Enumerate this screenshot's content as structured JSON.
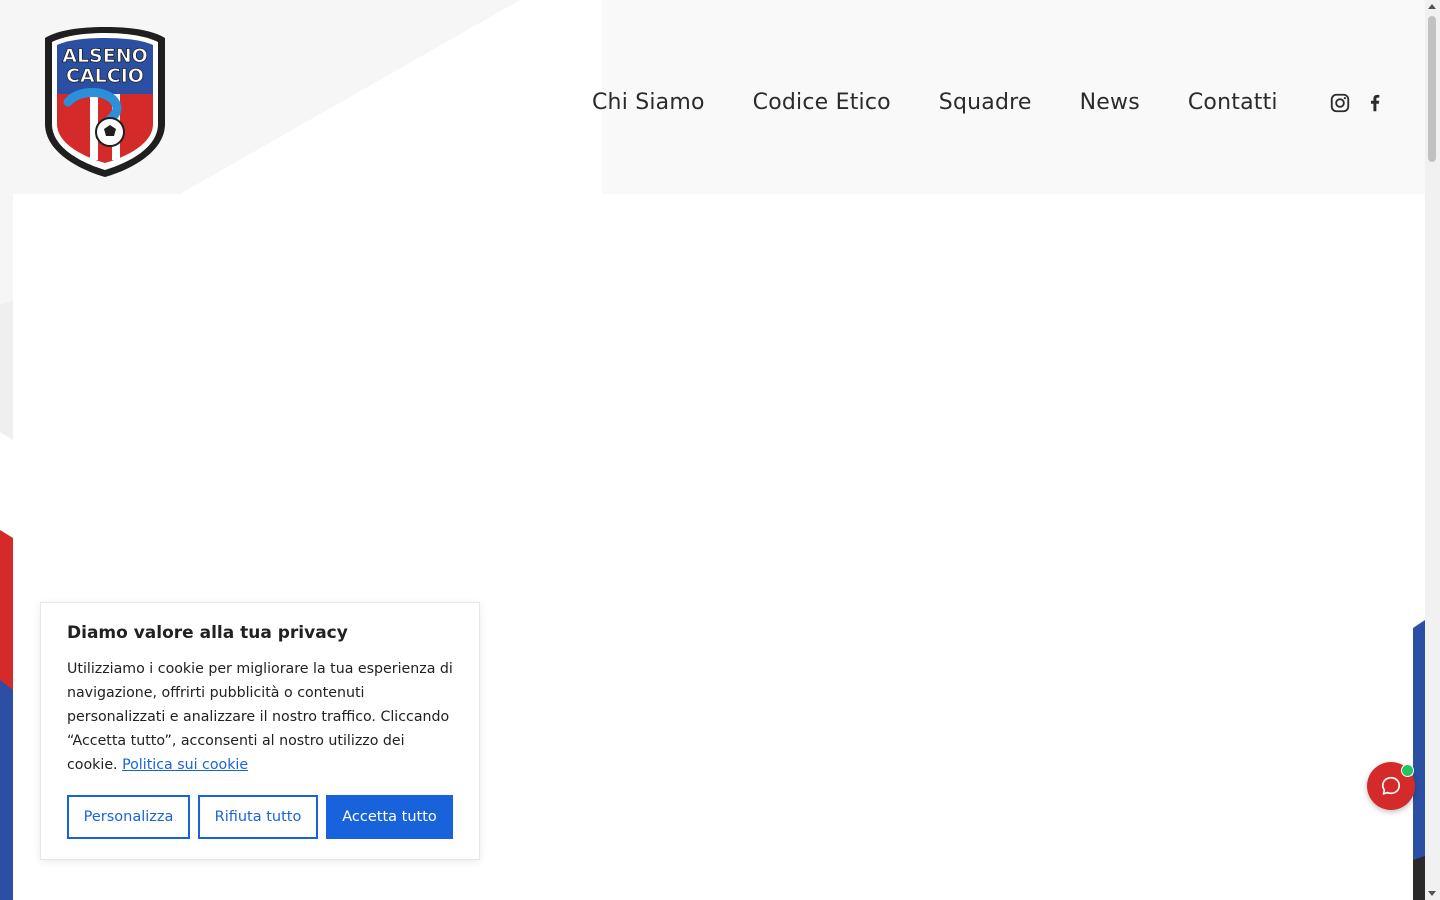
{
  "brand": {
    "logo_line1": "ALSENO",
    "logo_line2": "CALCIO",
    "colors": {
      "blue": "#2b4fa3",
      "red": "#d42a2a",
      "dark": "#1f1f1f"
    }
  },
  "nav": {
    "items": [
      {
        "label": "Chi Siamo"
      },
      {
        "label": "Codice Etico"
      },
      {
        "label": "Squadre"
      },
      {
        "label": "News"
      },
      {
        "label": "Contatti"
      }
    ],
    "social": [
      {
        "icon": "instagram-icon"
      },
      {
        "icon": "facebook-icon"
      }
    ]
  },
  "cookie_banner": {
    "title": "Diamo valore alla tua privacy",
    "text": "Utilizziamo i cookie per migliorare la tua esperienza di navigazione, offrirti pubblicità o contenuti personalizzati e analizzare il nostro traffico. Cliccando “Accetta tutto”, acconsenti al nostro utilizzo dei cookie.",
    "link_label": "Politica sui cookie",
    "buttons": {
      "customize": "Personalizza",
      "reject": "Rifiuta tutto",
      "accept": "Accetta tutto"
    },
    "accent_color": "#1863dc"
  },
  "chat": {
    "icon": "chat-bubble-icon",
    "status_color": "#22c55e"
  }
}
